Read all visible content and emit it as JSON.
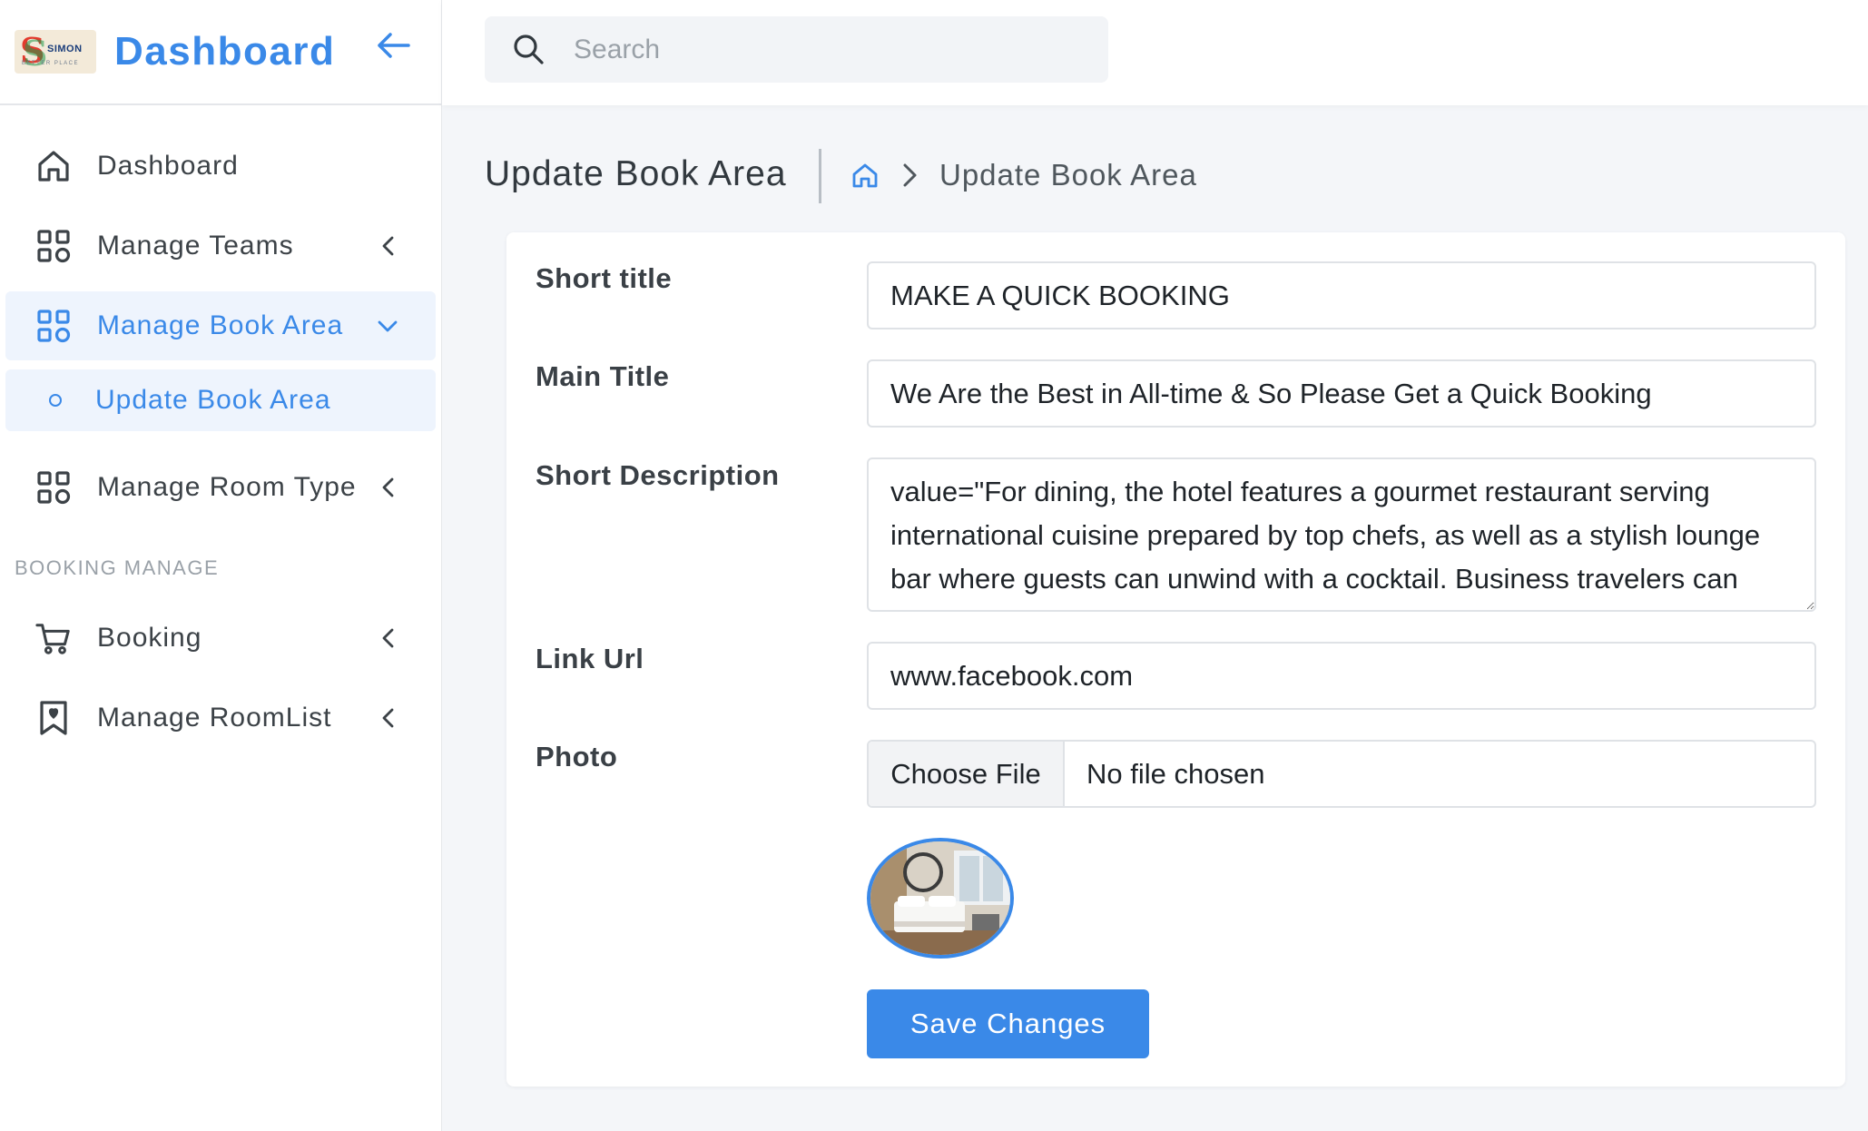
{
  "brand": {
    "logo_name": "SIMON",
    "logo_tagline": "BETTER PLACE",
    "title": "Dashboard"
  },
  "sidebar": {
    "items": [
      {
        "label": "Dashboard",
        "icon": "home-icon"
      },
      {
        "label": "Manage Teams",
        "icon": "grid-icon"
      },
      {
        "label": "Manage Book Area",
        "icon": "grid-icon",
        "active": true
      },
      {
        "label": "Update Book Area",
        "sub": true
      },
      {
        "label": "Manage Room Type",
        "icon": "grid-icon"
      }
    ],
    "section_label": "BOOKING MANAGE",
    "section_items": [
      {
        "label": "Booking",
        "icon": "cart-icon"
      },
      {
        "label": "Manage RoomList",
        "icon": "bookmark-heart-icon"
      }
    ]
  },
  "search": {
    "placeholder": "Search"
  },
  "page": {
    "title": "Update Book Area",
    "breadcrumb_current": "Update Book Area"
  },
  "form": {
    "short_title_label": "Short title",
    "short_title_value": "MAKE A QUICK BOOKING",
    "main_title_label": "Main Title",
    "main_title_value": "We Are the Best in All-time & So Please Get a Quick Booking",
    "short_desc_label": "Short Description",
    "short_desc_value": "value=\"For dining, the hotel features a gourmet restaurant serving international cuisine prepared by top chefs, as well as a stylish lounge bar where guests can unwind with a cocktail. Business travelers can take advantage of the fully equipped business center and meeting rooms.",
    "link_url_label": "Link Url",
    "link_url_value": "www.facebook.com",
    "photo_label": "Photo",
    "file_button": "Choose File",
    "file_status": "No file chosen",
    "save_label": "Save Changes"
  },
  "colors": {
    "accent": "#3a89e8",
    "active_bg": "#eef4fd",
    "page_bg": "#f4f6f9"
  }
}
